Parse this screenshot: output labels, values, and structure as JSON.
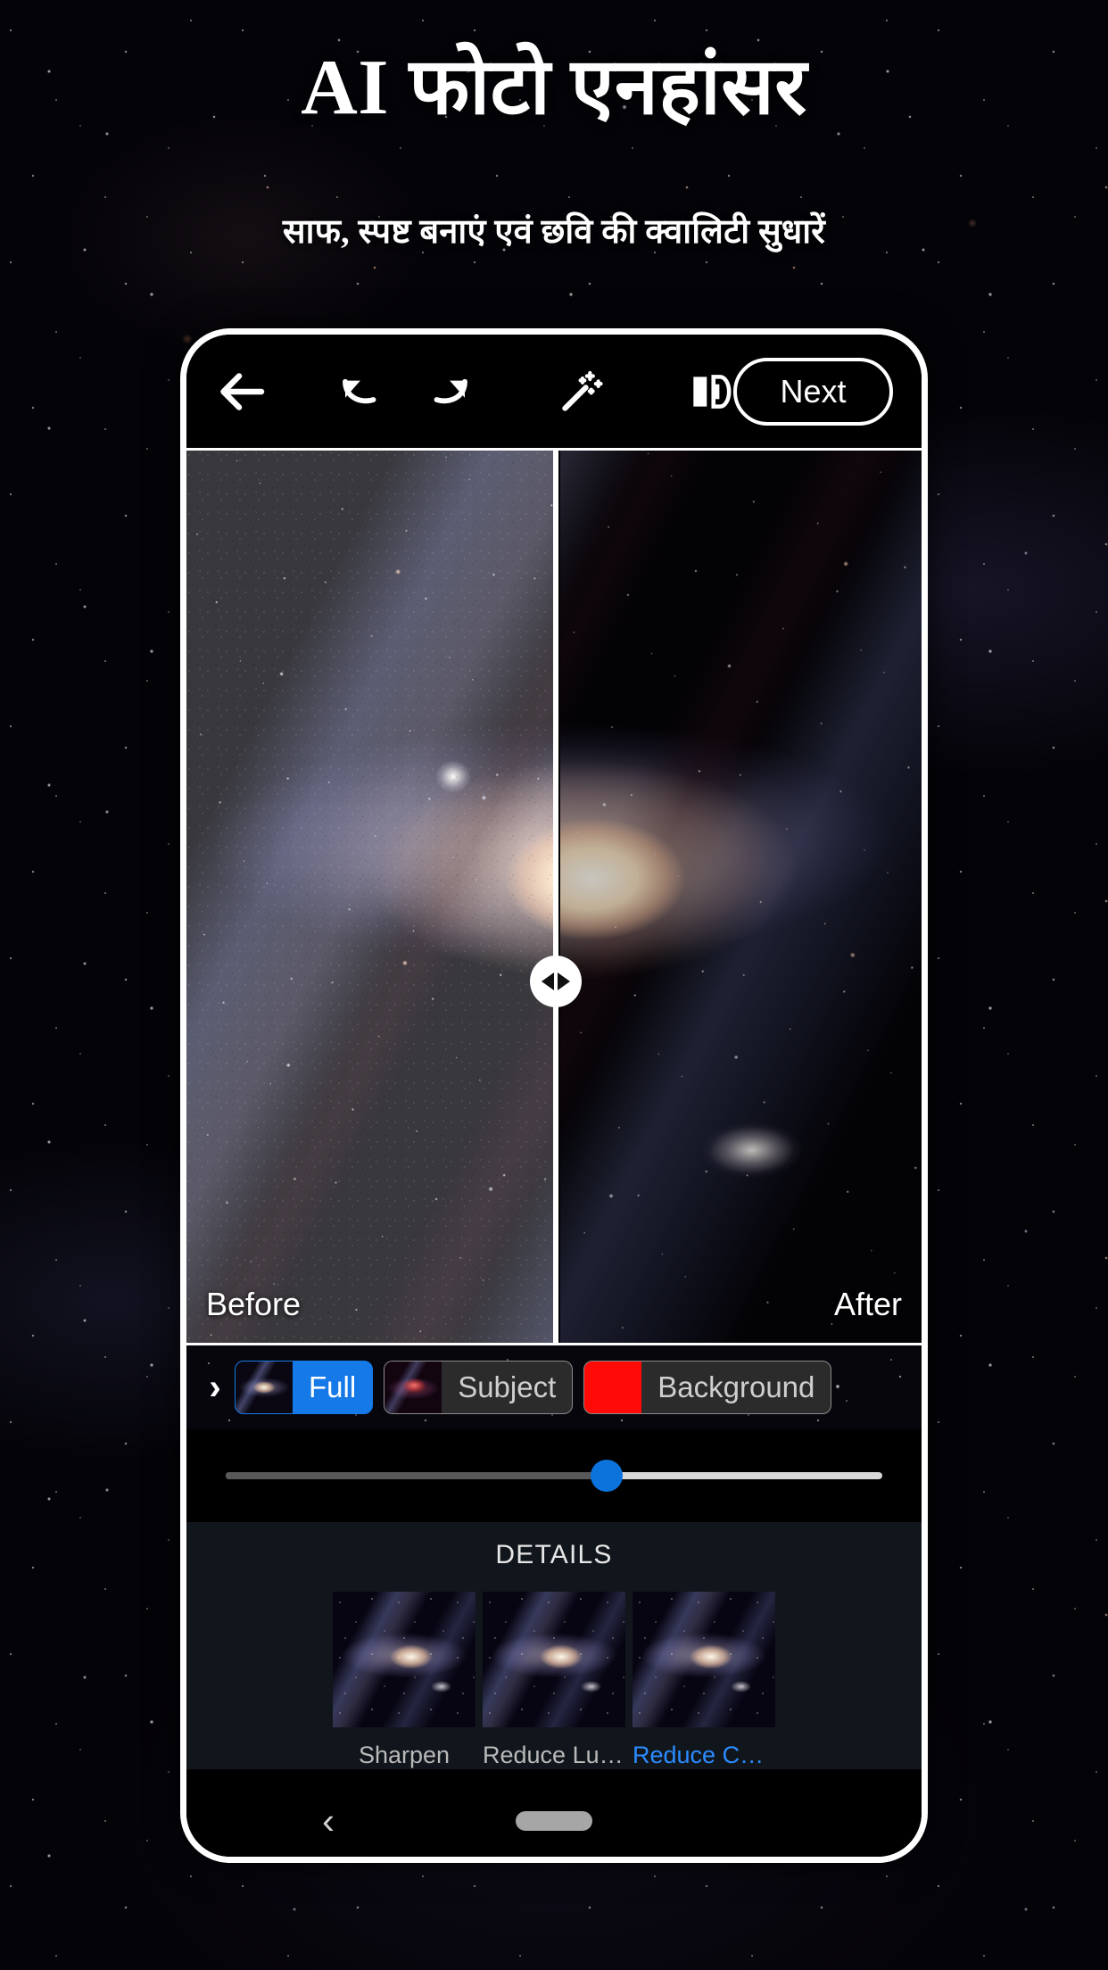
{
  "hero": {
    "title": "AI फोटो एनहांसर",
    "subtitle": "साफ, स्पष्ट बनाएं एवं छवि की क्वालिटी सुधारें"
  },
  "toolbar": {
    "back_icon": "arrow-left-icon",
    "undo_icon": "undo-icon",
    "redo_icon": "redo-icon",
    "magic_icon": "magic-wand-icon",
    "compare_icon": "split-compare-icon",
    "next_label": "Next"
  },
  "compare": {
    "before_label": "Before",
    "after_label": "After",
    "handle_icon": "compare-drag-handle-icon",
    "split_percent": 50
  },
  "modes": {
    "expand_icon": "chevron-right-icon",
    "chips": [
      {
        "label": "Full",
        "selected": true,
        "thumb": "galaxy-thumb"
      },
      {
        "label": "Subject",
        "selected": false,
        "thumb": "galaxy-red-thumb"
      },
      {
        "label": "Background",
        "selected": false,
        "thumb": "red-swatch-thumb"
      }
    ]
  },
  "strength_slider": {
    "value_percent": 58,
    "thumb_color": "#0c73dd",
    "track_color": "#d7d7d7",
    "filled_color": "#585858"
  },
  "details": {
    "section_title": "DETAILS",
    "tools": [
      {
        "label": "Sharpen",
        "active": false
      },
      {
        "label": "Reduce Lum..",
        "active": false
      },
      {
        "label": "Reduce Color",
        "active": true
      }
    ]
  },
  "navbar": {
    "back_icon": "chevron-left-icon",
    "home_pill_icon": "home-indicator-pill"
  },
  "colors": {
    "accent_blue": "#1579e8",
    "active_label_blue": "#2b8cff",
    "red_swatch": "#ff0a07",
    "panel_bg": "#11161d"
  }
}
